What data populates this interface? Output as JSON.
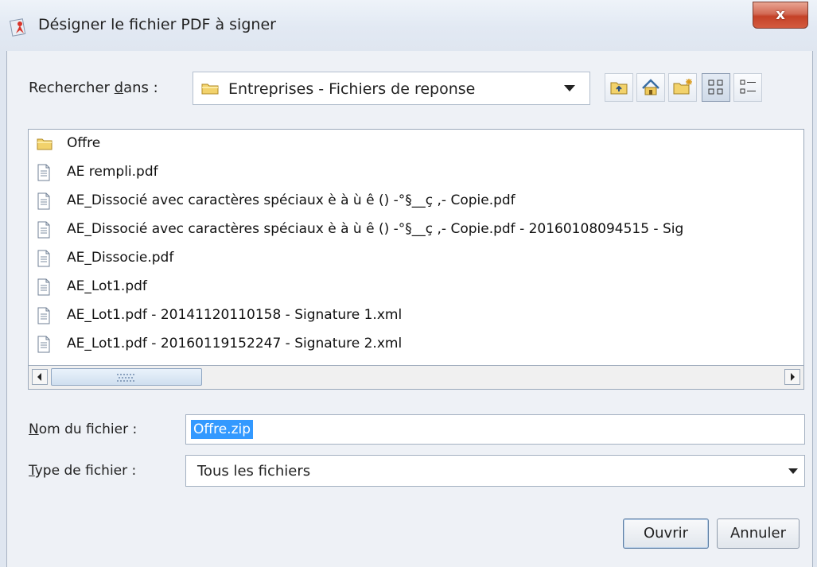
{
  "window": {
    "title": "Désigner le fichier PDF à signer",
    "close_glyph": "x"
  },
  "look_in": {
    "label_pre": "Rechercher ",
    "label_accel": "d",
    "label_post": "ans :",
    "value": "Entreprises - Fichiers de reponse"
  },
  "toolbar": {
    "icons": [
      "up-folder-icon",
      "home-icon",
      "new-folder-icon",
      "list-view-icon",
      "details-view-icon"
    ],
    "active_view": "list-view"
  },
  "files": [
    {
      "type": "folder",
      "name": "Offre"
    },
    {
      "type": "file",
      "name": "AE rempli.pdf"
    },
    {
      "type": "file",
      "name": "AE_Dissocié avec caractères spéciaux è à ù ê () -°§__ç ,- Copie.pdf"
    },
    {
      "type": "file",
      "name": "AE_Dissocié avec caractères spéciaux è à ù ê () -°§__ç ,- Copie.pdf - 20160108094515 - Sig"
    },
    {
      "type": "file",
      "name": "AE_Dissocie.pdf"
    },
    {
      "type": "file",
      "name": "AE_Lot1.pdf"
    },
    {
      "type": "file",
      "name": "AE_Lot1.pdf - 20141120110158 - Signature 1.xml"
    },
    {
      "type": "file",
      "name": "AE_Lot1.pdf - 20160119152247 - Signature 2.xml"
    }
  ],
  "file_name": {
    "label_accel": "N",
    "label_post": "om du fichier :",
    "value": "Offre.zip"
  },
  "file_type": {
    "label_accel": "T",
    "label_post": "ype de fichier :",
    "value": "Tous les fichiers"
  },
  "buttons": {
    "open": "Ouvrir",
    "cancel": "Annuler"
  },
  "colors": {
    "selection": "#3399ff",
    "close_button": "#c44127",
    "folder": "#f2d26b"
  }
}
